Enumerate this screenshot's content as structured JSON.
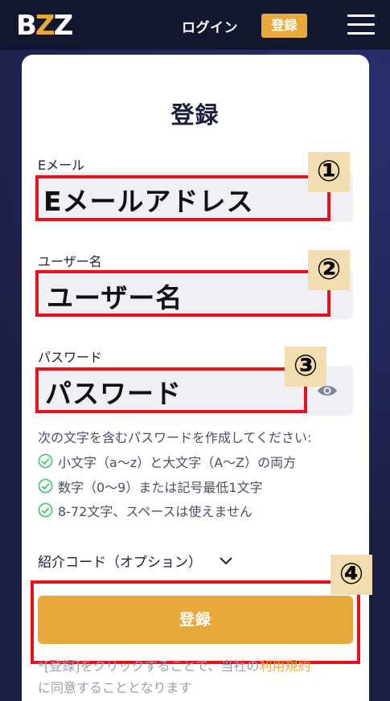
{
  "header": {
    "logo_text": "B",
    "logo_accent": "Z",
    "logo_text_end": "Z",
    "login_label": "ログイン",
    "register_label": "登録"
  },
  "form": {
    "title": "登録",
    "email": {
      "label": "Eメール",
      "placeholder": "Eメールアドレス",
      "badge": "①"
    },
    "username": {
      "label": "ユーザー名",
      "placeholder": "ユーザー名",
      "badge": "②"
    },
    "password": {
      "label": "パスワード",
      "placeholder": "パスワード",
      "badge": "③"
    },
    "rules_heading": "次の文字を含むパスワードを作成してください:",
    "rules": [
      "小文字（a〜z）と大文字（A〜Z）の両方",
      "数字（0〜9）または記号最低1文字",
      "8-72文字、スペースは使えません"
    ],
    "referral_label": "紹介コード（オプション）",
    "register_badge": "④",
    "submit_label": "登録",
    "terms_prefix": "*[登録]をクリックすることで、当社の",
    "terms_link": "利用規約",
    "terms_suffix": "に同意することとなります"
  },
  "colors": {
    "accent": "#e8a93a",
    "highlight_frame": "#e8101f",
    "check": "#3dbf6e",
    "background": "#1c1f45"
  }
}
